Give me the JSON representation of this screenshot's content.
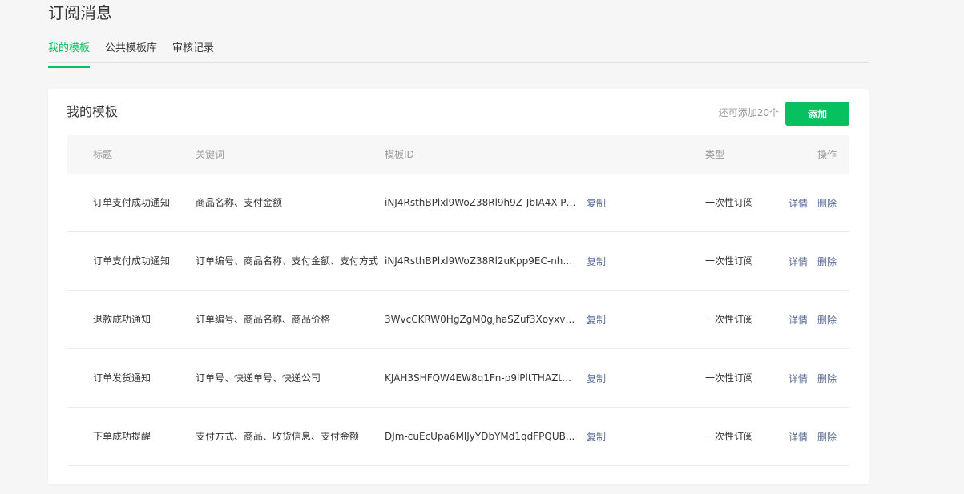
{
  "page_title": "订阅消息",
  "tabs": [
    {
      "label": "我的模板",
      "active": true
    },
    {
      "label": "公共模板库",
      "active": false
    },
    {
      "label": "审核记录",
      "active": false
    }
  ],
  "card": {
    "title": "我的模板",
    "remaining": "还可添加20个",
    "add_label": "添加"
  },
  "columns": {
    "title": "标题",
    "keywords": "关键词",
    "template_id": "模板ID",
    "type": "类型",
    "actions": "操作"
  },
  "rows": [
    {
      "title": "订单支付成功通知",
      "keywords": "商品名称、支付金额",
      "template_id": "iNJ4RsthBPlxl9WoZ38Rl9h9Z-JbIA4X-P5...",
      "copy": "复制",
      "type": "一次性订阅",
      "detail": "详情",
      "delete": "删除"
    },
    {
      "title": "订单支付成功通知",
      "keywords": "订单编号、商品名称、支付金额、支付方式",
      "template_id": "iNJ4RsthBPlxl9WoZ38Rl2uKpp9EC-nhz3...",
      "copy": "复制",
      "type": "一次性订阅",
      "detail": "详情",
      "delete": "删除"
    },
    {
      "title": "退款成功通知",
      "keywords": "订单编号、商品名称、商品价格",
      "template_id": "3WvcCKRW0HgZgM0gjhaSZuf3XoyxvpJ...",
      "copy": "复制",
      "type": "一次性订阅",
      "detail": "详情",
      "delete": "删除"
    },
    {
      "title": "订单发货通知",
      "keywords": "订单号、快递单号、快递公司",
      "template_id": "KJAH3SHFQW4EW8q1Fn-p9lPltTHAZtE...",
      "copy": "复制",
      "type": "一次性订阅",
      "detail": "详情",
      "delete": "删除"
    },
    {
      "title": "下单成功提醒",
      "keywords": "支付方式、商品、收货信息、支付金额",
      "template_id": "DJm-cuEcUpa6MlJyYDbYMd1qdFPQUB...",
      "copy": "复制",
      "type": "一次性订阅",
      "detail": "详情",
      "delete": "删除"
    }
  ],
  "colors": {
    "accent": "#07c160",
    "link": "#576b95",
    "muted": "#9a9a9a"
  }
}
